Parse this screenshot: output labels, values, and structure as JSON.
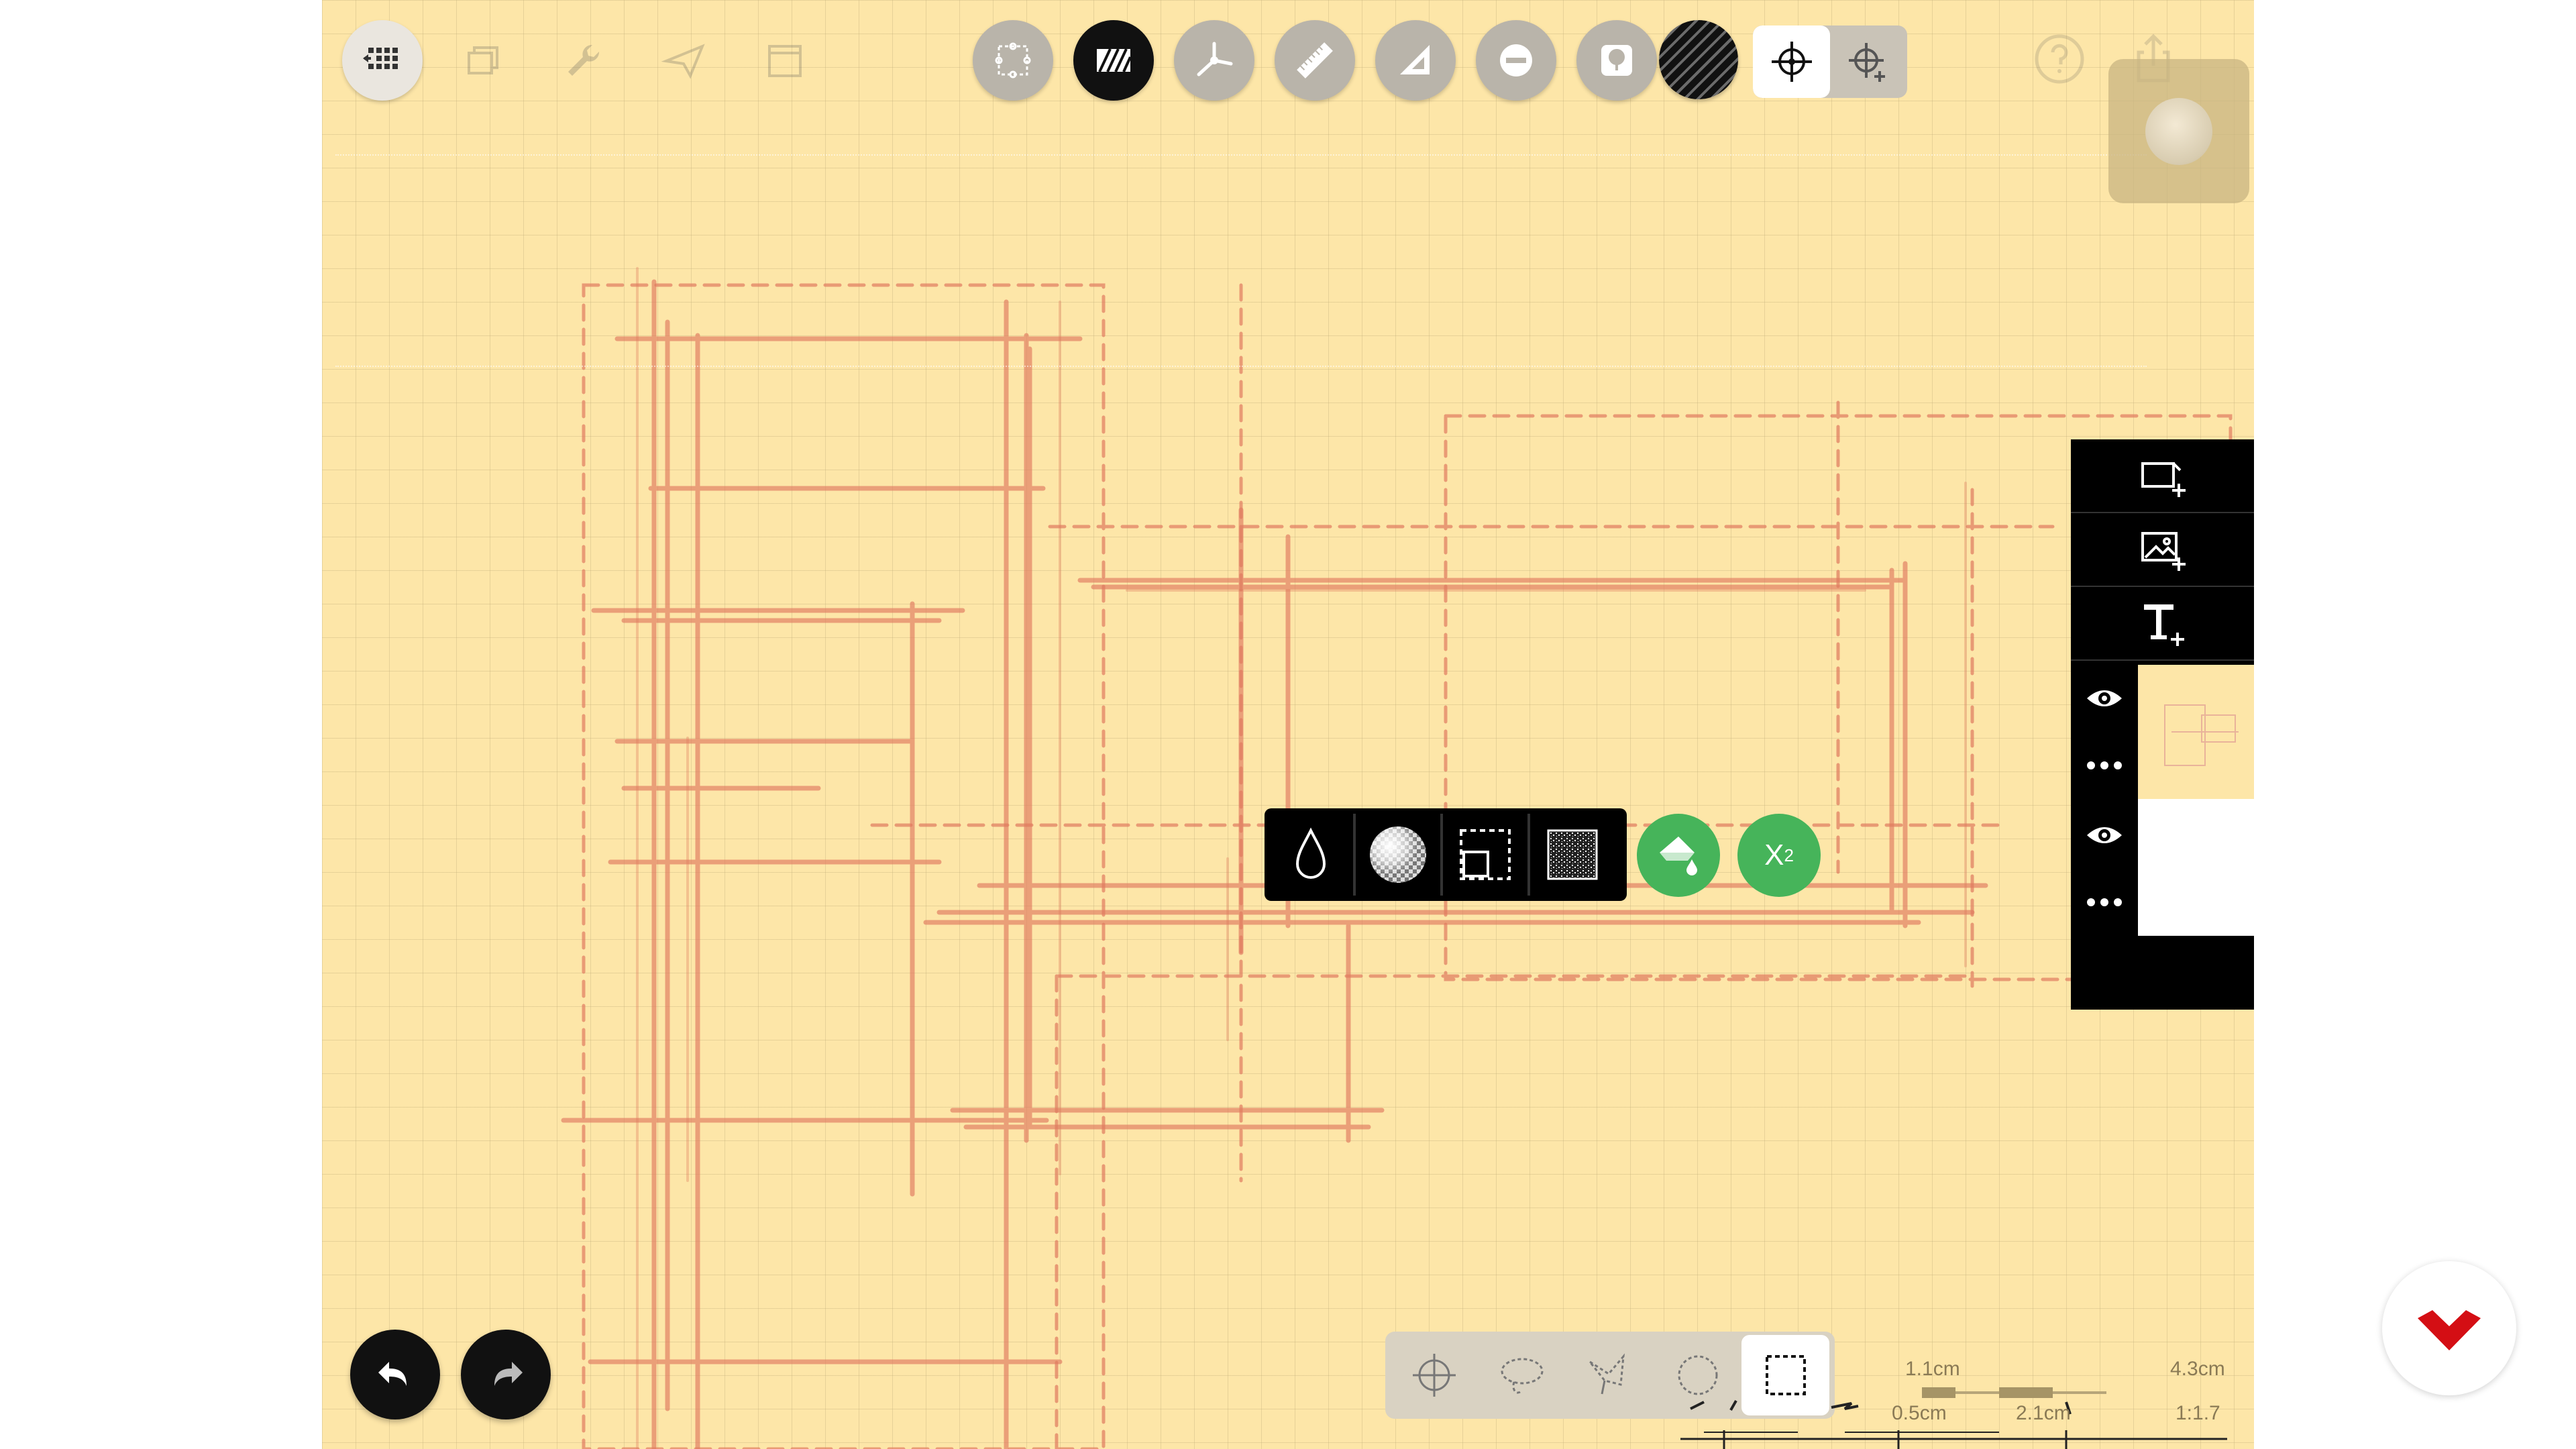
{
  "colors": {
    "paper": "#fde6a8",
    "grid": "#bea978",
    "sketch_line": "#e07a5f",
    "toolbar_gray": "#b9b4aa",
    "active_black": "#111111",
    "panel_black": "#000000",
    "accent_green": "#46b45a",
    "logo_red": "#d40e14"
  },
  "top_toolbar": {
    "left_tools": [
      {
        "icon": "gallery-grid-icon",
        "state": "active"
      },
      {
        "icon": "layers-copy-icon",
        "state": "disabled"
      },
      {
        "icon": "wrench-icon",
        "state": "disabled"
      },
      {
        "icon": "paper-plane-icon",
        "state": "disabled"
      },
      {
        "icon": "folder-icon",
        "state": "disabled"
      }
    ],
    "center_tools": [
      {
        "icon": "transform-handles-icon",
        "state": "normal"
      },
      {
        "icon": "hatch-fill-icon",
        "state": "selected"
      },
      {
        "icon": "perspective-guide-icon",
        "state": "normal"
      },
      {
        "icon": "ruler-icon",
        "state": "normal"
      },
      {
        "icon": "set-square-icon",
        "state": "normal"
      },
      {
        "icon": "ellipse-guide-icon",
        "state": "normal"
      },
      {
        "icon": "tree-stamp-icon",
        "state": "normal"
      }
    ],
    "brush_swatch": "hatch-pattern-swatch",
    "snap_toggle": [
      {
        "icon": "snap-crosshair-icon",
        "state": "on"
      },
      {
        "icon": "snap-grid-icon",
        "state": "off"
      }
    ],
    "right_tools": [
      {
        "icon": "help-icon",
        "state": "disabled"
      },
      {
        "icon": "share-icon",
        "state": "disabled"
      }
    ]
  },
  "pressure_pad": {
    "icon": "pressure-dot-icon"
  },
  "layers_panel": {
    "add_buttons": [
      {
        "icon": "add-page-icon"
      },
      {
        "icon": "add-image-icon"
      },
      {
        "icon": "add-text-icon"
      }
    ],
    "layers": [
      {
        "visibility_icon": "eye-icon",
        "menu_icon": "more-dots-icon",
        "thumb": "sketch-preview",
        "visible": true
      },
      {
        "visibility_icon": "eye-icon",
        "menu_icon": "more-dots-icon",
        "thumb": "blank",
        "visible": true
      }
    ]
  },
  "brush_popup": {
    "items": [
      {
        "icon": "opacity-drop-icon"
      },
      {
        "icon": "blend-checker-icon"
      },
      {
        "icon": "selection-frame-icon"
      },
      {
        "icon": "texture-noise-icon"
      }
    ],
    "fill_icon": "paint-bucket-icon",
    "power_label": "X",
    "power_exponent": "2"
  },
  "history": {
    "undo_icon": "undo-icon",
    "redo_icon": "redo-icon"
  },
  "selection_toolbar": [
    {
      "icon": "crosshair-select-icon",
      "state": "normal"
    },
    {
      "icon": "lasso-icon",
      "state": "normal"
    },
    {
      "icon": "polygon-lasso-icon",
      "state": "normal"
    },
    {
      "icon": "ellipse-select-icon",
      "state": "normal"
    },
    {
      "icon": "rect-select-icon",
      "state": "selected"
    }
  ],
  "scale_bar": {
    "top_left_label": "1.1cm",
    "top_right_label": "4.3cm",
    "bottom_left_label": "0.5cm",
    "bottom_mid_label": "2.1cm",
    "ratio": "1:1.7"
  },
  "logo": {
    "icon": "red-heart-logo-icon"
  }
}
